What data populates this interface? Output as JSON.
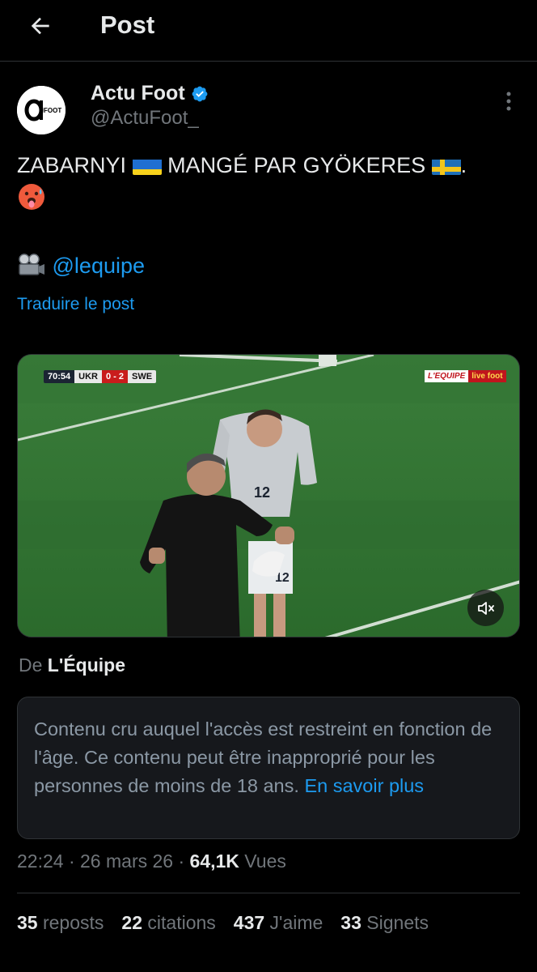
{
  "header": {
    "title": "Post",
    "back_icon": "arrow-left-icon"
  },
  "author": {
    "display_name": "Actu Foot",
    "handle": "@ActuFoot_",
    "verified": true,
    "avatar_text": "FOOT",
    "verified_color": "#1d9bf0"
  },
  "tweet": {
    "line1_a": "ZABARNYI",
    "line1_b": "MANGÉ PAR GYÖKERES",
    "line1_c": ".",
    "flags": [
      "ukraine-flag-icon",
      "sweden-flag-icon"
    ],
    "emoji": "hot-face-emoji",
    "source_icon": "film-camera-icon",
    "mention": "@lequipe",
    "translate": "Traduire le post"
  },
  "media": {
    "match_time": "70:54",
    "home": "UKR",
    "score": "0 - 2",
    "away": "SWE",
    "broadcaster_a": "L'EQUIPE",
    "broadcaster_b": "live foot",
    "player_number": "12",
    "mute_icon": "speaker-muted-icon"
  },
  "source": {
    "prefix": "De",
    "name": "L'Équipe"
  },
  "warning": {
    "text": "Contenu cru auquel l'accès est restreint en fonction de l'âge. Ce contenu peut être inapproprié pour les personnes de moins de 18 ans.",
    "link": "En savoir plus"
  },
  "meta": {
    "time": "22:24",
    "sep1": "·",
    "date": "26 mars 26",
    "sep2": "·",
    "views": "64,1K",
    "views_label": "Vues"
  },
  "stats": {
    "reposts": "35",
    "reposts_label": "reposts",
    "quotes": "22",
    "quotes_label": "citations",
    "likes": "437",
    "likes_label": "J'aime",
    "bookmarks": "33",
    "bookmarks_label": "Signets"
  },
  "colors": {
    "background": "#000000",
    "text": "#e7e9ea",
    "muted": "#71767b",
    "link": "#1d9bf0",
    "border": "#2f3336"
  }
}
